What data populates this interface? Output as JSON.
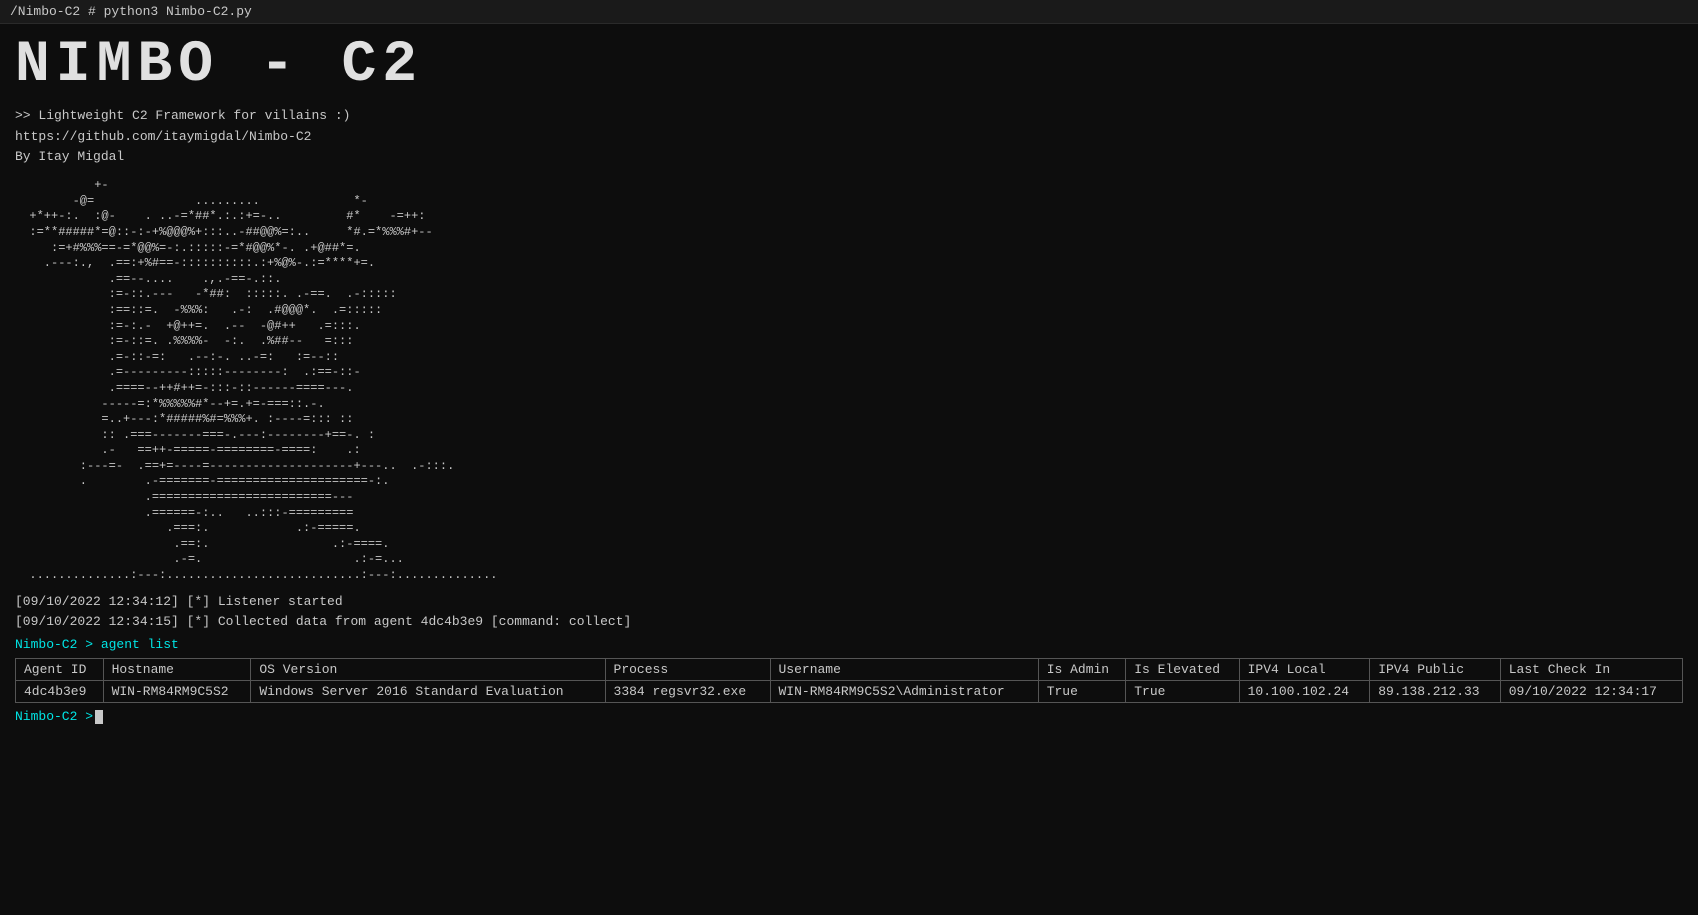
{
  "titleBar": {
    "text": "/Nimbo-C2 # python3 Nimbo-C2.py"
  },
  "logo": {
    "text": "NIMBO - C2"
  },
  "subtitle": {
    "line1": ">> Lightweight C2 Framework for villains :)",
    "line2": "   https://github.com/itaymigdal/Nimbo-C2",
    "line3": "   By Itay Migdal"
  },
  "asciiArt": "           +-\n        -@=              .........             *-\n  +*++-:.  :@-    . ..-=*##*.:.:+=-..         #*    -=++:\n  :=**#####*=@::-:-+%@@@%+:::..-##@@%=:..     *#.=*%%%#+--\n     :=+#%%%==-=*@@%=-:.:::::-=*#@@%*-. .+@##*=.\n    .---:.,  .==:+%#==-::::::::::.:+%@%-.:=****+=.\n             .==--....    .,.-==-.::.\n             :=-::.---   -*##:  :::::. .-==.  .-:::::\n             :==::=.  -%%%:   .-:  .#@@@*.  .=:::::\n             :=-:.-  +@++=.  .--  -@#++   .=:::.\n             :=-::=. .%%%%-  -:.  .%##--   =:::\n             .=-::-=:   .--:-. ..-=:   :=--::\n             .=---------:::::--------:  .:==-::-\n             .====--++#++=-:::-::------====---.\n            -----=:*%%%%%#*--+=.+=-===::.-.\n            =..+---:*#####%#=%%%+. :----=::: ::\n            :: .===-------===-.---:--------+==-. :\n            .-   ==++-=====-========-====:    .:\n         :---=-  .==+=----=--------------------+---..  .-:::.\n         .        .-=======-=====================-:.\n                  .=========================---\n                  .======-:..   ..:::-=========\n                     .===:.            .:-=====.\n                      .==:.                 .:-====.\n                      .-=.                     .:-=...\n  ..............:---:...........................:---:..............",
  "logs": [
    "[09/10/2022 12:34:12] [*] Listener started",
    "[09/10/2022 12:34:15] [*] Collected data from agent 4dc4b3e9 [command: collect]"
  ],
  "promptAgentList": "Nimbo-C2 > agent list",
  "table": {
    "headers": [
      "Agent ID",
      "Hostname",
      "OS Version",
      "Process",
      "Username",
      "Is Admin",
      "Is Elevated",
      "IPV4 Local",
      "IPV4 Public",
      "Last Check In"
    ],
    "rows": [
      {
        "agentId": "4dc4b3e9",
        "hostname": "WIN-RM84RM9C5S2",
        "osVersion": "Windows Server 2016 Standard Evaluation",
        "process": "3384 regsvr32.exe",
        "username": "WIN-RM84RM9C5S2\\Administrator",
        "isAdmin": "True",
        "isElevated": "True",
        "ipv4Local": "10.100.102.24",
        "ipv4Public": "89.138.212.33",
        "lastCheckIn": "09/10/2022 12:34:17"
      }
    ]
  },
  "finalPrompt": "Nimbo-C2 > "
}
